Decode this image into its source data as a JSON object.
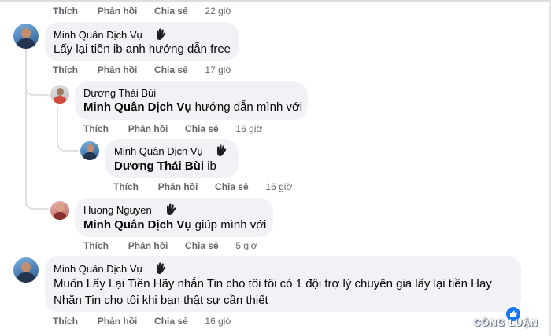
{
  "actions": {
    "like": "Thích",
    "reply": "Phản hồi",
    "share": "Chia sẻ"
  },
  "comments": [
    {
      "time": "22 giờ"
    },
    {
      "author": "Minh Quân Dịch Vụ",
      "text": "Lấy lại tiền ib anh hướng dẫn free",
      "time": "17 giờ"
    },
    {
      "author": "Dương Thái Bùi",
      "mention": "Minh Quân Dịch Vụ",
      "text": " hướng dẫn mình với",
      "time": "16 giờ"
    },
    {
      "author": "Minh Quân Dịch Vụ",
      "mention": "Dương Thái Bùi",
      "text": " ib",
      "time": "16 giờ"
    },
    {
      "author": "Huong Nguyen",
      "mention": "Minh Quân Dịch Vụ",
      "text": " giúp mình với",
      "time": "5 giờ"
    },
    {
      "author": "Minh Quân Dịch Vụ",
      "text_line1": "Muốn Lấy Lại Tiền Hãy nhắn Tin cho tôi tôi có 1 đội trợ lý chuyên gia lấy lại tiền Hay",
      "text_line2": "Nhắn Tin cho tôi khi bạn thật sự cần thiết",
      "time": "16 giờ"
    }
  ],
  "watermark": "CÔNG LUẬN",
  "colors": {
    "bubble": "#f0f2f5",
    "action_text": "#65676b",
    "reaction": "#1877f2"
  }
}
